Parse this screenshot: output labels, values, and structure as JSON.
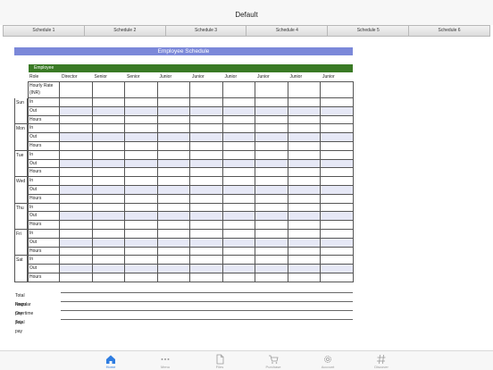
{
  "header": {
    "title": "Default"
  },
  "tabs": [
    "Schedule 1",
    "Schedule 2",
    "Schedule 3",
    "Schedule 4",
    "Schedule 5",
    "Schedule 6"
  ],
  "sheet": {
    "title": "Employee Schedule",
    "employee_label": "Employee",
    "role_label": "Role",
    "roles": [
      "Director",
      "Senior",
      "Senior",
      "Junior",
      "Junior",
      "Junior",
      "Junior",
      "Junior",
      "Junior"
    ],
    "hourly_rate_label": "Hourly Rate (INR)",
    "days": [
      "Sun",
      "Mon",
      "Tue",
      "Wed",
      "Thu",
      "Fri",
      "Sat"
    ],
    "row_labels": [
      "In",
      "Out",
      "Hours"
    ]
  },
  "totals": [
    "Total hours",
    "Regular pay",
    "Overtime pay",
    "Total pay"
  ],
  "tabbar": [
    {
      "label": "Home",
      "icon": "home-icon",
      "active": true
    },
    {
      "label": "Menu",
      "icon": "more-icon",
      "active": false
    },
    {
      "label": "Files",
      "icon": "file-icon",
      "active": false
    },
    {
      "label": "Purchase",
      "icon": "cart-icon",
      "active": false
    },
    {
      "label": "Account",
      "icon": "gear-icon",
      "active": false
    },
    {
      "label": "Discover",
      "icon": "hashtag-icon",
      "active": false
    }
  ],
  "colors": {
    "title_bar": "#7b88d9",
    "employee_bar": "#3a7a25",
    "accent": "#2f7de1",
    "shade": "#e6e8f6"
  }
}
